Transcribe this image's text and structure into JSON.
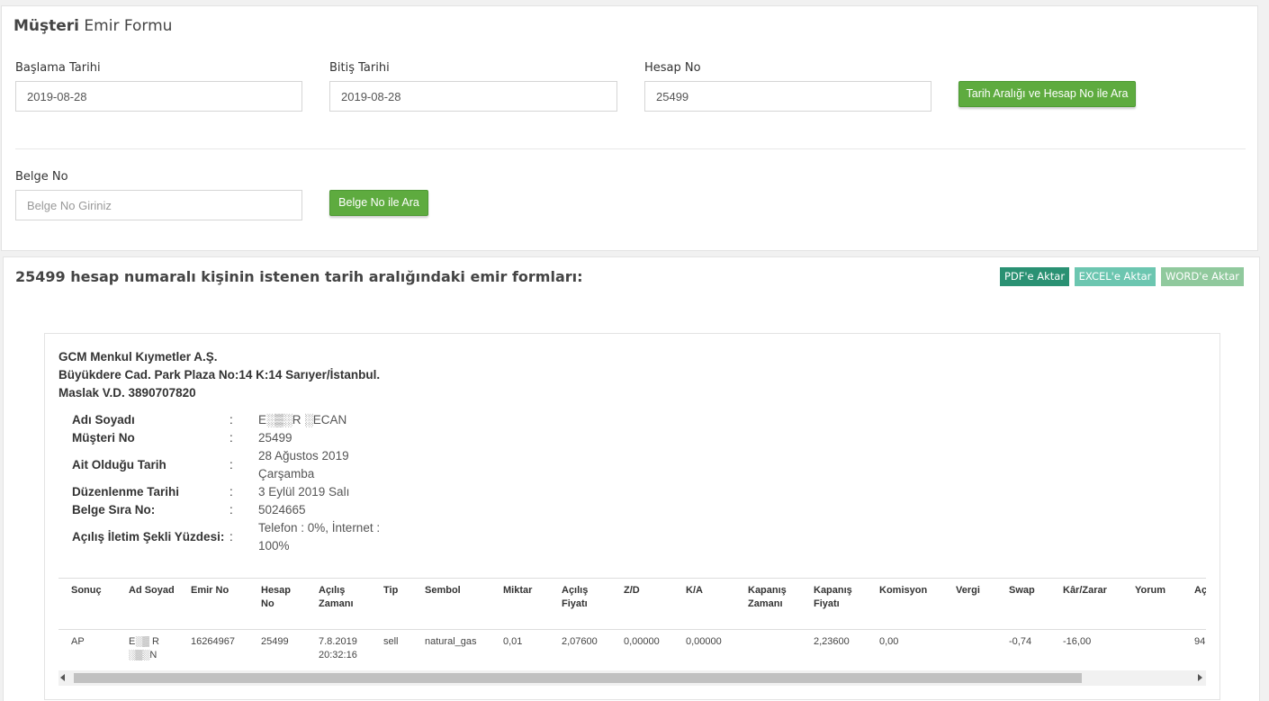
{
  "form": {
    "title_bold": "Müşteri",
    "title_rest": " Emir Formu",
    "start_label": "Başlama Tarihi",
    "start_value": "2019-08-28",
    "end_label": "Bitiş Tarihi",
    "end_value": "2019-08-28",
    "account_label": "Hesap No",
    "account_value": "25499",
    "search_range_button": "Tarih Aralığı ve Hesap No ile Ara",
    "doc_label": "Belge No",
    "doc_placeholder": "Belge No Giriniz",
    "search_doc_button": "Belge No ile Ara"
  },
  "results": {
    "title": "25499 hesap numaralı kişinin istenen tarih aralığındaki emir formları:",
    "export_buttons": [
      {
        "label": "PDF'e Aktar",
        "color": "#2a9173"
      },
      {
        "label": "EXCEL'e Aktar",
        "color": "#6cc6b0"
      },
      {
        "label": "WORD'e Aktar",
        "color": "#90c99d"
      }
    ]
  },
  "document": {
    "company_lines": [
      "GCM Menkul Kıymetler A.Ş.",
      "Büyükdere Cad. Park Plaza No:14 K:14 Sarıyer/İstanbul.",
      "Maslak V.D. 3890707820"
    ],
    "info": [
      {
        "key": "Adı Soyadı",
        "value": "E░▒░R ░ECAN"
      },
      {
        "key": "Müşteri No",
        "value": "25499"
      },
      {
        "key": "Ait Olduğu Tarih",
        "value": "28 Ağustos 2019 Çarşamba"
      },
      {
        "key": "Düzenlenme Tarihi",
        "value": "3 Eylül 2019 Salı"
      },
      {
        "key": "Belge Sıra No:",
        "value": "5024665"
      },
      {
        "key": "Açılış İletim Şekli Yüzdesi:",
        "value": "Telefon : 0%, İnternet : 100%"
      }
    ],
    "separator": ":",
    "columns": [
      "Sonuç",
      "Ad Soyad",
      "Emir No",
      "Hesap No",
      "Açılış Zamanı",
      "Tip",
      "Sembol",
      "Miktar",
      "Açılış Fiyatı",
      "Z/D",
      "K/A",
      "Kapanış Zamanı",
      "Kapanış Fiyatı",
      "Komisyon",
      "Vergi",
      "Swap",
      "Kâr/Zarar",
      "Yorum",
      "Aç"
    ],
    "rows": [
      [
        "AP",
        "E░▒ R ░▒░N",
        "16264967",
        "25499",
        "7.8.2019 20:32:16",
        "sell",
        "natural_gas",
        "0,01",
        "2,07600",
        "0,00000",
        "0,00000",
        "",
        "2,23600",
        "0,00",
        "",
        "-0,74",
        "-16,00",
        "",
        "94"
      ]
    ]
  }
}
